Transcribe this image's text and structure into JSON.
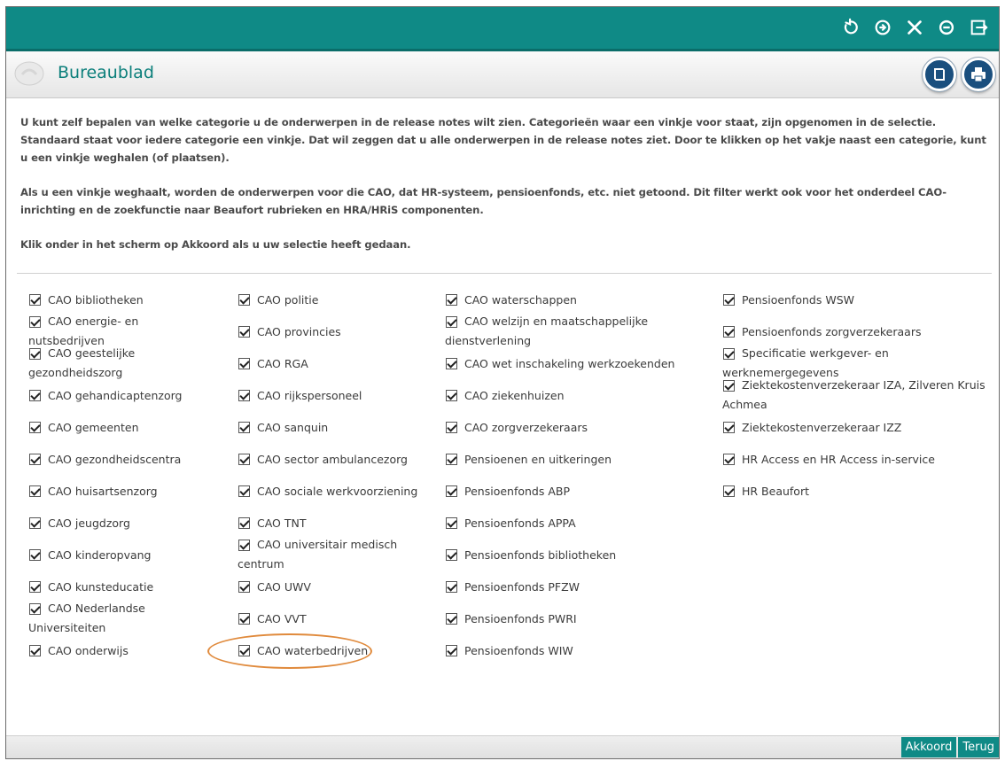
{
  "header": {
    "title": "Bureaublad"
  },
  "intro": {
    "p1": "U kunt zelf bepalen van welke categorie u de onderwerpen in de release notes wilt zien. Categorieën waar een vinkje voor staat, zijn opgenomen in de selectie. Standaard staat voor iedere categorie een vinkje. Dat wil zeggen dat u alle onderwerpen in de release notes ziet. Door te klikken op het vakje naast een categorie, kunt u een vinkje weghalen (of plaatsen).",
    "p2": "Als u een vinkje weghaalt, worden de onderwerpen voor die CAO, dat HR-systeem, pensioenfonds, etc. niet getoond. Dit filter werkt ook voor het onderdeel CAO-inrichting en de zoekfunctie naar Beaufort rubrieken en HRA/HRiS componenten.",
    "p3": "Klik onder in het scherm op Akkoord als u uw selectie heeft gedaan."
  },
  "categories": {
    "col1": [
      {
        "l1": "CAO bibliotheken",
        "l2": ""
      },
      {
        "l1": "CAO energie- en",
        "l2": "nutsbedrijven"
      },
      {
        "l1": "CAO geestelijke",
        "l2": "gezondheidszorg"
      },
      {
        "l1": "CAO gehandicaptenzorg",
        "l2": ""
      },
      {
        "l1": "CAO gemeenten",
        "l2": ""
      },
      {
        "l1": "CAO gezondheidscentra",
        "l2": ""
      },
      {
        "l1": "CAO huisartsenzorg",
        "l2": ""
      },
      {
        "l1": "CAO jeugdzorg",
        "l2": ""
      },
      {
        "l1": "CAO kinderopvang",
        "l2": ""
      },
      {
        "l1": "CAO kunsteducatie",
        "l2": ""
      },
      {
        "l1": "CAO Nederlandse",
        "l2": "Universiteiten"
      },
      {
        "l1": "CAO onderwijs",
        "l2": ""
      }
    ],
    "col2": [
      {
        "l1": "CAO politie",
        "l2": ""
      },
      {
        "l1": "CAO provincies",
        "l2": ""
      },
      {
        "l1": "CAO RGA",
        "l2": ""
      },
      {
        "l1": "CAO rijkspersoneel",
        "l2": ""
      },
      {
        "l1": "CAO sanquin",
        "l2": ""
      },
      {
        "l1": "CAO sector ambulancezorg",
        "l2": ""
      },
      {
        "l1": "CAO sociale werkvoorziening",
        "l2": ""
      },
      {
        "l1": "CAO TNT",
        "l2": ""
      },
      {
        "l1": "CAO universitair medisch",
        "l2": "centrum"
      },
      {
        "l1": "CAO UWV",
        "l2": ""
      },
      {
        "l1": "CAO VVT",
        "l2": ""
      },
      {
        "l1": "CAO waterbedrijven",
        "l2": ""
      }
    ],
    "col3": [
      {
        "l1": "CAO waterschappen",
        "l2": ""
      },
      {
        "l1": "CAO welzijn en maatschappelijke",
        "l2": "dienstverlening"
      },
      {
        "l1": "CAO wet inschakeling werkzoekenden",
        "l2": ""
      },
      {
        "l1": "CAO ziekenhuizen",
        "l2": ""
      },
      {
        "l1": "CAO zorgverzekeraars",
        "l2": ""
      },
      {
        "l1": "Pensioenen en uitkeringen",
        "l2": ""
      },
      {
        "l1": "Pensioenfonds ABP",
        "l2": ""
      },
      {
        "l1": "Pensioenfonds APPA",
        "l2": ""
      },
      {
        "l1": "Pensioenfonds bibliotheken",
        "l2": ""
      },
      {
        "l1": "Pensioenfonds PFZW",
        "l2": ""
      },
      {
        "l1": "Pensioenfonds PWRI",
        "l2": ""
      },
      {
        "l1": "Pensioenfonds WIW",
        "l2": ""
      }
    ],
    "col4": [
      {
        "l1": "Pensioenfonds WSW",
        "l2": ""
      },
      {
        "l1": "Pensioenfonds zorgverzekeraars",
        "l2": ""
      },
      {
        "l1": "Specificatie werkgever- en",
        "l2": "werknemergegevens"
      },
      {
        "l1": "Ziektekostenverzekeraar IZA, Zilveren Kruis",
        "l2": "Achmea"
      },
      {
        "l1": "Ziektekostenverzekeraar IZZ",
        "l2": ""
      },
      {
        "l1": "HR Access en HR Access in-service",
        "l2": ""
      },
      {
        "l1": "HR Beaufort",
        "l2": ""
      }
    ]
  },
  "footer": {
    "ok_label": "Akkoord",
    "back_label": "Terug"
  },
  "colors": {
    "teal": "#0f8a86",
    "title": "#0c7f7b",
    "round_button": "#1a4f7e",
    "highlight": "#e08a3c"
  },
  "icons": [
    "refresh-icon",
    "forward-icon",
    "tools-icon",
    "minus-circle-icon",
    "logout-icon",
    "book-icon",
    "print-icon"
  ]
}
